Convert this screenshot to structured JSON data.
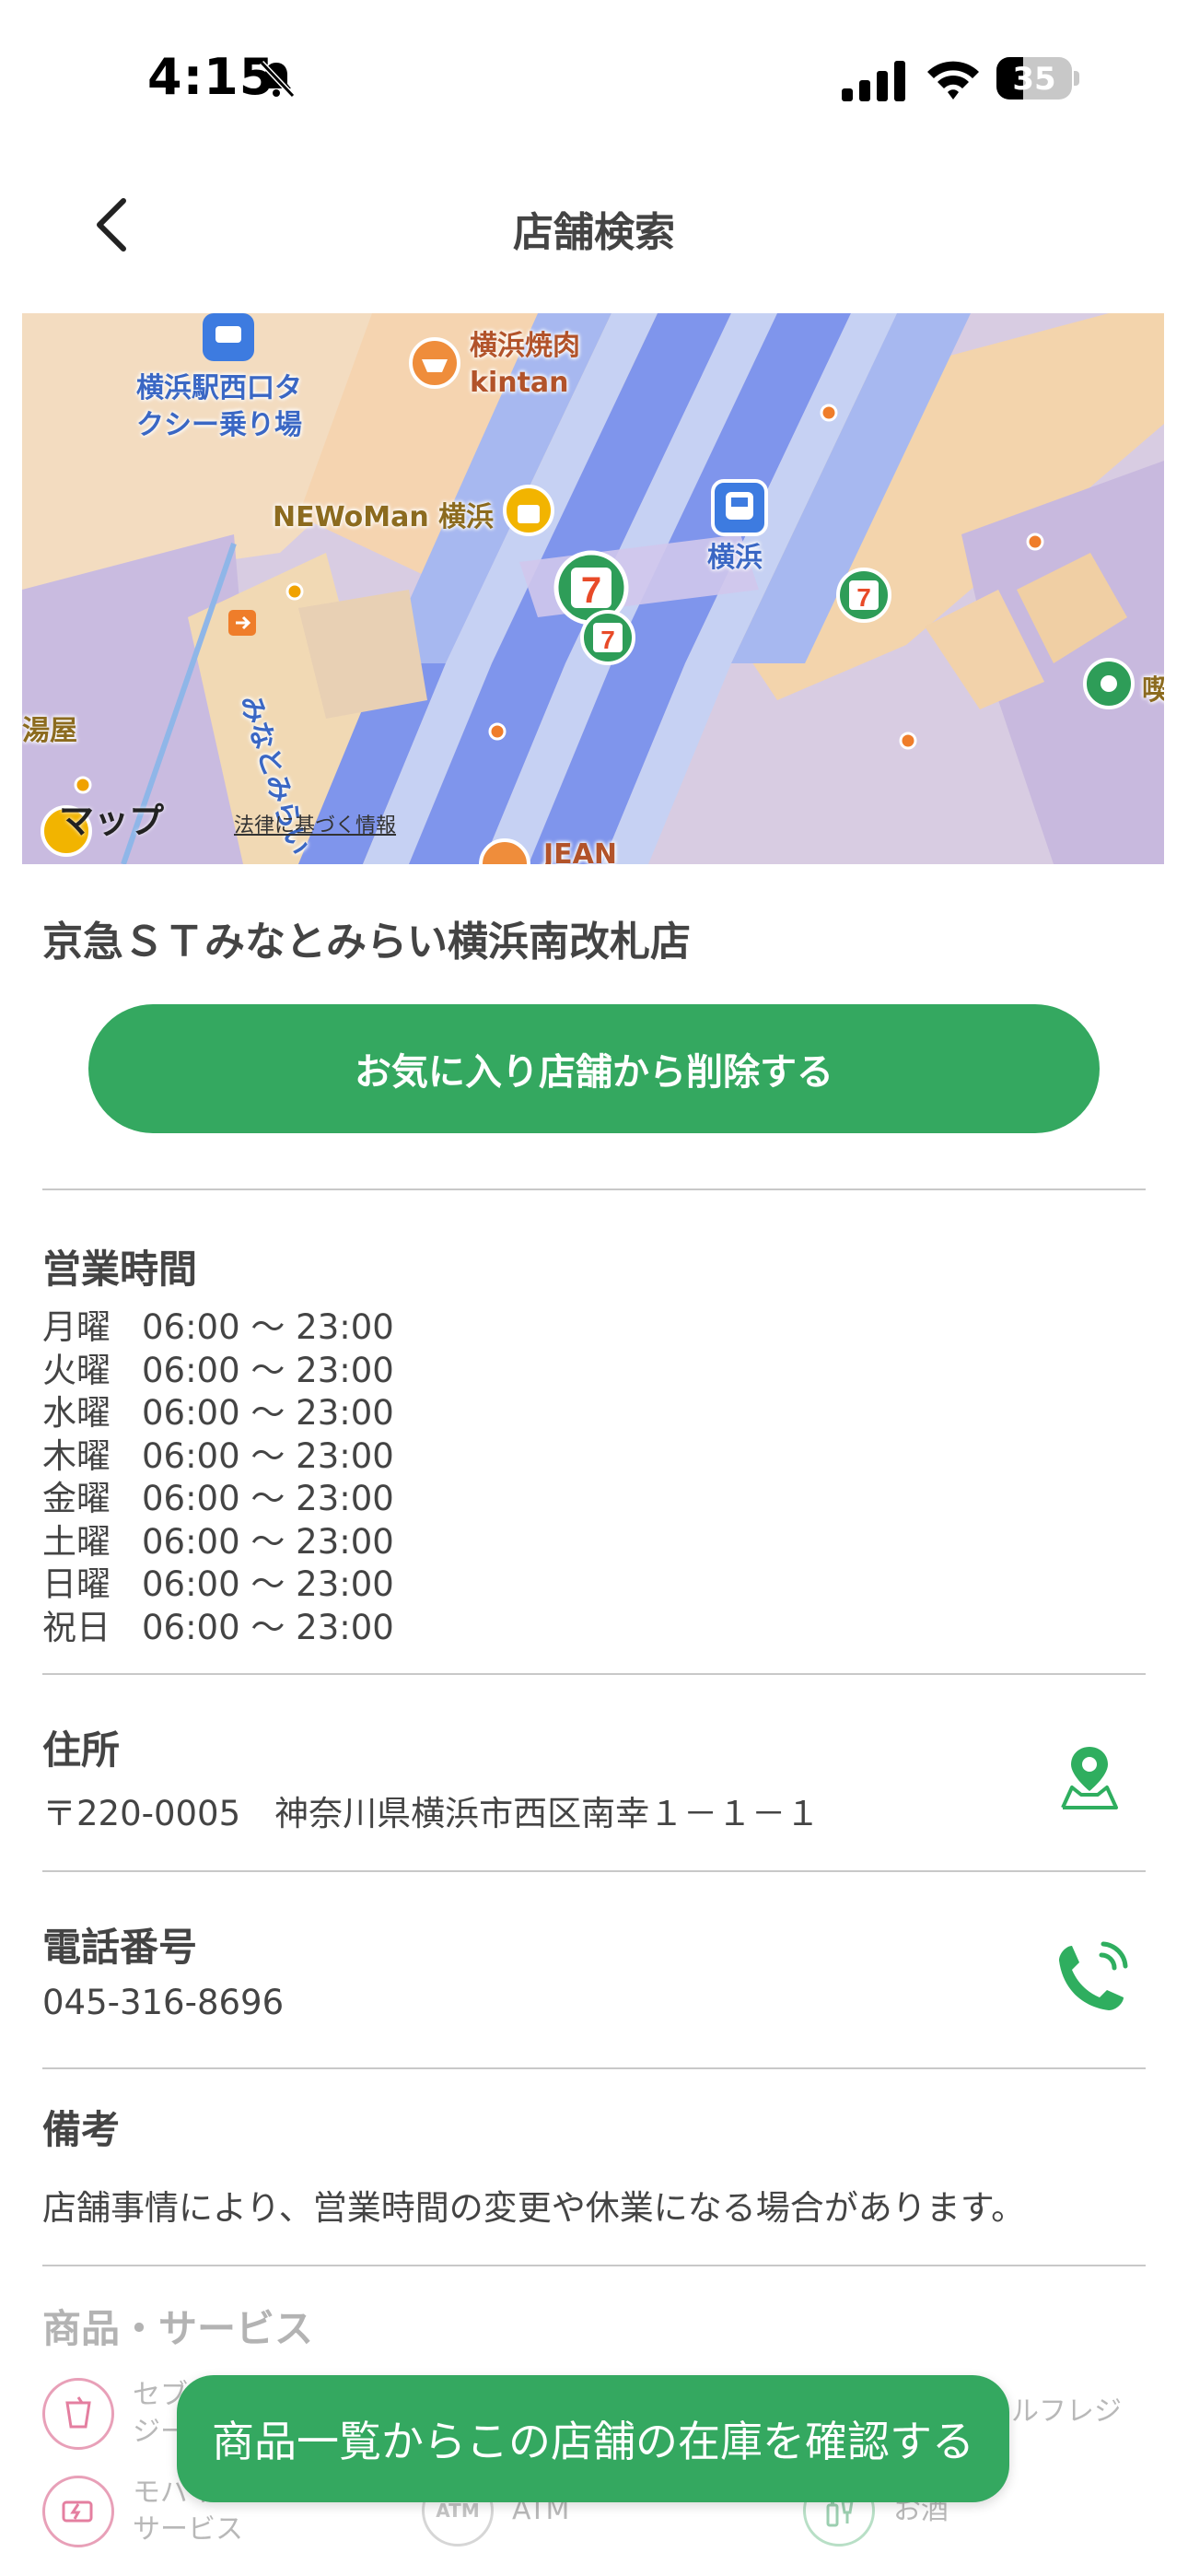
{
  "status_bar": {
    "time": "4:15",
    "battery_level": "35",
    "battery_fraction": 0.35
  },
  "nav": {
    "title": "店舗検索"
  },
  "map": {
    "labels": {
      "taxi": "横浜駅西口タクシー乗り場",
      "taxi_line1": "横浜駅西口タ",
      "taxi_line2": "クシー乗り場",
      "yakiniku_line1": "横浜焼肉",
      "yakiniku_line2": "kintan",
      "newoman": "NEWoMan 横浜",
      "station": "横浜",
      "minatomirai": "みなとみらい",
      "left_edge": "湯屋",
      "right_edge": "喫",
      "jean": "JEAN"
    },
    "brand": "マップ",
    "legal": "法律に基づく情報"
  },
  "store": {
    "name": "京急ＳＴみなとみらい横浜南改札店",
    "fav_button": "お気に入り店舗から削除する"
  },
  "hours": {
    "title": "営業時間",
    "rows": [
      {
        "day": "月曜",
        "time": "06:00 〜 23:00"
      },
      {
        "day": "火曜",
        "time": "06:00 〜 23:00"
      },
      {
        "day": "水曜",
        "time": "06:00 〜 23:00"
      },
      {
        "day": "木曜",
        "time": "06:00 〜 23:00"
      },
      {
        "day": "金曜",
        "time": "06:00 〜 23:00"
      },
      {
        "day": "土曜",
        "time": "06:00 〜 23:00"
      },
      {
        "day": "日曜",
        "time": "06:00 〜 23:00"
      },
      {
        "day": "祝日",
        "time": "06:00 〜 23:00"
      }
    ]
  },
  "address": {
    "title": "住所",
    "value": "〒220-0005　神奈川県横浜市西区南幸１－１－１"
  },
  "phone": {
    "title": "電話番号",
    "value": "045-316-8696"
  },
  "notes": {
    "title": "備考",
    "value": "店舗事情により、営業時間の変更や休業になる場合があります。"
  },
  "services": {
    "title": "商品・サービス",
    "items": [
      {
        "label_line1": "セブ",
        "label_line2": "ジー"
      },
      {
        "label_line1": "ルフレジ",
        "label_line2": ""
      },
      {
        "label_line1": "モバイ",
        "label_line2": "サービス"
      },
      {
        "label_line1": "ATM",
        "label_line2": ""
      },
      {
        "label_line1": "お酒",
        "label_line2": ""
      }
    ]
  },
  "stock_button": "商品一覧からこの店舗の在庫を確認する",
  "colors": {
    "accent_green": "#34a860",
    "divider": "#c8c8c8"
  }
}
